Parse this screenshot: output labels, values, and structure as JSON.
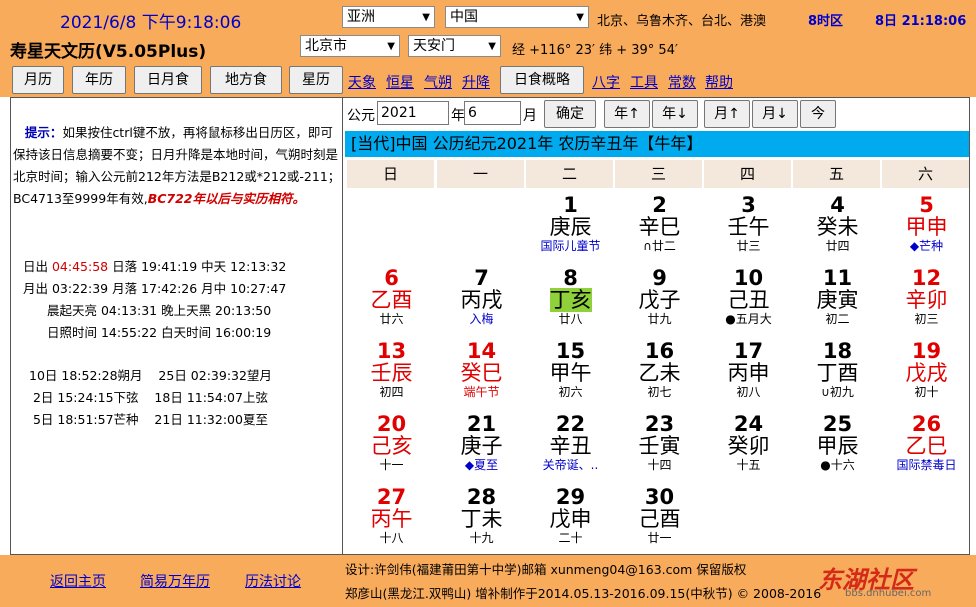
{
  "header": {
    "datetime": "2021/6/8  下午9:18:06",
    "app_title": "寿星天文历(V5.05Plus)",
    "continent": "亚洲",
    "country": "中国",
    "cities": "北京、乌鲁木齐、台北、港澳",
    "timezone": "8时区",
    "day_time": "8日 21:18:06",
    "city": "北京市",
    "site": "天安门",
    "coords": "经 +116° 23′ 纬 + 39° 54′"
  },
  "nav": {
    "buttons": [
      "月历",
      "年历",
      "日月食",
      "地方食",
      "星历",
      "日食概略"
    ],
    "links": [
      "天象",
      "恒星",
      "气朔",
      "升降",
      "八字",
      "工具",
      "常数",
      "帮助"
    ]
  },
  "left": {
    "tip_label": "提示：",
    "tip_text": "如果按住ctrl键不放，再将鼠标移出日历区，即可保持该日信息摘要不变；日月升降是本地时间，气朔时刻是北京时间；输入公元前212年方法是B212或*212或-211；BC4713至9999年有效,",
    "tip_red": "BC722年以后与实历相符。",
    "sun_line_a": "日出 ",
    "sun_rise": "04:45:58",
    "sun_line_b": " 日落 19:41:19 中天 12:13:32",
    "moon_line": "月出 03:22:39 月落 17:42:26 月中 10:27:47",
    "dawn_line": "晨起天亮 04:13:31 晚上天黑 20:13:50",
    "daylight_line": "日照时间 14:55:22 白天时间 16:00:19",
    "phases": [
      "10日 18:52:28朔月    25日 02:39:32望月",
      " 2日 15:24:15下弦    18日 11:54:07上弦",
      " 5日 18:51:57芒种    21日 11:32:00夏至"
    ]
  },
  "controls": {
    "era_label": "公元",
    "year": "2021",
    "year_label": "年",
    "month": "6",
    "month_label": "月",
    "confirm": "确定",
    "year_up": "年↑",
    "year_down": "年↓",
    "month_up": "月↑",
    "month_down": "月↓",
    "today": "今"
  },
  "calendar": {
    "banner": "[当代]中国  公历纪元2021年  农历辛丑年【牛年】",
    "weekdays": [
      "日",
      "一",
      "二",
      "三",
      "四",
      "五",
      "六"
    ],
    "days": [
      {
        "d": "1",
        "gz": "庚辰",
        "lu": "国际儿童节",
        "dc": "#000",
        "gc": "#000",
        "lc": "#0000cc"
      },
      {
        "d": "2",
        "gz": "辛巳",
        "lu": "∩廿二",
        "dc": "#000",
        "gc": "#000",
        "lc": "#000"
      },
      {
        "d": "3",
        "gz": "壬午",
        "lu": "廿三",
        "dc": "#000",
        "gc": "#000",
        "lc": "#000"
      },
      {
        "d": "4",
        "gz": "癸未",
        "lu": "廿四",
        "dc": "#000",
        "gc": "#000",
        "lc": "#000"
      },
      {
        "d": "5",
        "gz": "甲申",
        "lu": "◆芒种",
        "dc": "#e00000",
        "gc": "#e00000",
        "lc": "#0000cc"
      },
      {
        "d": "6",
        "gz": "乙酉",
        "lu": "廿六",
        "dc": "#e00000",
        "gc": "#e00000",
        "lc": "#000"
      },
      {
        "d": "7",
        "gz": "丙戌",
        "lu": "入梅",
        "dc": "#000",
        "gc": "#000",
        "lc": "#0000cc"
      },
      {
        "d": "8",
        "gz": "丁亥",
        "lu": "廿八",
        "dc": "#000",
        "gc": "#000",
        "lc": "#000"
      },
      {
        "d": "9",
        "gz": "戊子",
        "lu": "廿九",
        "dc": "#000",
        "gc": "#000",
        "lc": "#000"
      },
      {
        "d": "10",
        "gz": "己丑",
        "lu": "●五月大",
        "dc": "#000",
        "gc": "#000",
        "lc": "#000"
      },
      {
        "d": "11",
        "gz": "庚寅",
        "lu": "初二",
        "dc": "#000",
        "gc": "#000",
        "lc": "#000"
      },
      {
        "d": "12",
        "gz": "辛卯",
        "lu": "初三",
        "dc": "#e00000",
        "gc": "#e00000",
        "lc": "#000"
      },
      {
        "d": "13",
        "gz": "壬辰",
        "lu": "初四",
        "dc": "#e00000",
        "gc": "#e00000",
        "lc": "#000"
      },
      {
        "d": "14",
        "gz": "癸巳",
        "lu": "端午节",
        "dc": "#e00000",
        "gc": "#e00000",
        "lc": "#e00000"
      },
      {
        "d": "15",
        "gz": "甲午",
        "lu": "初六",
        "dc": "#000",
        "gc": "#000",
        "lc": "#000"
      },
      {
        "d": "16",
        "gz": "乙未",
        "lu": "初七",
        "dc": "#000",
        "gc": "#000",
        "lc": "#000"
      },
      {
        "d": "17",
        "gz": "丙申",
        "lu": "初八",
        "dc": "#000",
        "gc": "#000",
        "lc": "#000"
      },
      {
        "d": "18",
        "gz": "丁酉",
        "lu": "∪初九",
        "dc": "#000",
        "gc": "#000",
        "lc": "#000"
      },
      {
        "d": "19",
        "gz": "戊戌",
        "lu": "初十",
        "dc": "#e00000",
        "gc": "#e00000",
        "lc": "#000"
      },
      {
        "d": "20",
        "gz": "己亥",
        "lu": "十一",
        "dc": "#e00000",
        "gc": "#e00000",
        "lc": "#000"
      },
      {
        "d": "21",
        "gz": "庚子",
        "lu": "◆夏至",
        "dc": "#000",
        "gc": "#000",
        "lc": "#0000cc"
      },
      {
        "d": "22",
        "gz": "辛丑",
        "lu": "关帝诞、..",
        "dc": "#000",
        "gc": "#000",
        "lc": "#0000cc"
      },
      {
        "d": "23",
        "gz": "壬寅",
        "lu": "十四",
        "dc": "#000",
        "gc": "#000",
        "lc": "#000"
      },
      {
        "d": "24",
        "gz": "癸卯",
        "lu": "十五",
        "dc": "#000",
        "gc": "#000",
        "lc": "#000"
      },
      {
        "d": "25",
        "gz": "甲辰",
        "lu": "●十六",
        "dc": "#000",
        "gc": "#000",
        "lc": "#000"
      },
      {
        "d": "26",
        "gz": "乙巳",
        "lu": "国际禁毒日",
        "dc": "#e00000",
        "gc": "#e00000",
        "lc": "#0000cc"
      },
      {
        "d": "27",
        "gz": "丙午",
        "lu": "十八",
        "dc": "#e00000",
        "gc": "#e00000",
        "lc": "#000"
      },
      {
        "d": "28",
        "gz": "丁未",
        "lu": "十九",
        "dc": "#000",
        "gc": "#000",
        "lc": "#000"
      },
      {
        "d": "29",
        "gz": "戊申",
        "lu": "二十",
        "dc": "#000",
        "gc": "#000",
        "lc": "#000"
      },
      {
        "d": "30",
        "gz": "己酉",
        "lu": "廿一",
        "dc": "#000",
        "gc": "#000",
        "lc": "#000"
      }
    ],
    "first_weekday": 2,
    "selected_day": "8",
    "highlight_color": "#8ed13a"
  },
  "footer": {
    "links": [
      "返回主页",
      "简易万年历",
      "历法讨论"
    ],
    "credit1": "设计:许剑伟(福建莆田第十中学)邮箱 xunmeng04@163.com 保留版权",
    "credit2": "郑彦山(黑龙江.双鸭山) 增补制作于2014.05.13-2016.09.15(中秋节) © 2008-2016",
    "watermark": "东湖社区",
    "watermark_url": "bbs.dnhubei.com"
  }
}
